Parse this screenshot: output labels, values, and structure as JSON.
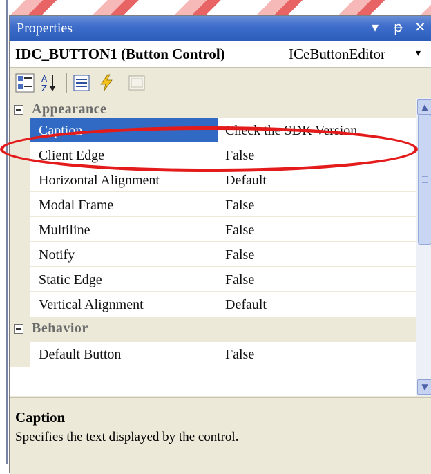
{
  "window": {
    "title": "Properties",
    "pin_glyph": "▾",
    "autohide_glyph": "ᵽ",
    "close_glyph": "✕"
  },
  "object_selector": {
    "name": "IDC_BUTTON1 (Button Control)",
    "type": "ICeButtonEditor",
    "arrow_glyph": "▾"
  },
  "toolbar": {
    "icons": [
      "categorized-icon",
      "alphabetical-icon",
      "properties-icon",
      "events-icon",
      "property-pages-icon"
    ]
  },
  "grid": {
    "categories": [
      {
        "label": "Appearance",
        "properties": [
          {
            "name": "Caption",
            "value": "Check the SDK Version",
            "selected": true
          },
          {
            "name": "Client Edge",
            "value": "False"
          },
          {
            "name": "Horizontal Alignment",
            "value": "Default"
          },
          {
            "name": "Modal Frame",
            "value": "False"
          },
          {
            "name": "Multiline",
            "value": "False"
          },
          {
            "name": "Notify",
            "value": "False"
          },
          {
            "name": "Static Edge",
            "value": "False"
          },
          {
            "name": "Vertical Alignment",
            "value": "Default"
          }
        ]
      },
      {
        "label": "Behavior",
        "properties": [
          {
            "name": "Default Button",
            "value": "False"
          }
        ]
      }
    ]
  },
  "scrollbar": {
    "up_glyph": "▲",
    "down_glyph": "▼"
  },
  "description": {
    "title": "Caption",
    "text": "Specifies the text displayed by the control."
  },
  "colors": {
    "selection": "#316ac5",
    "highlight": "#e41b1b",
    "title_bar": "#3f6ecb"
  }
}
